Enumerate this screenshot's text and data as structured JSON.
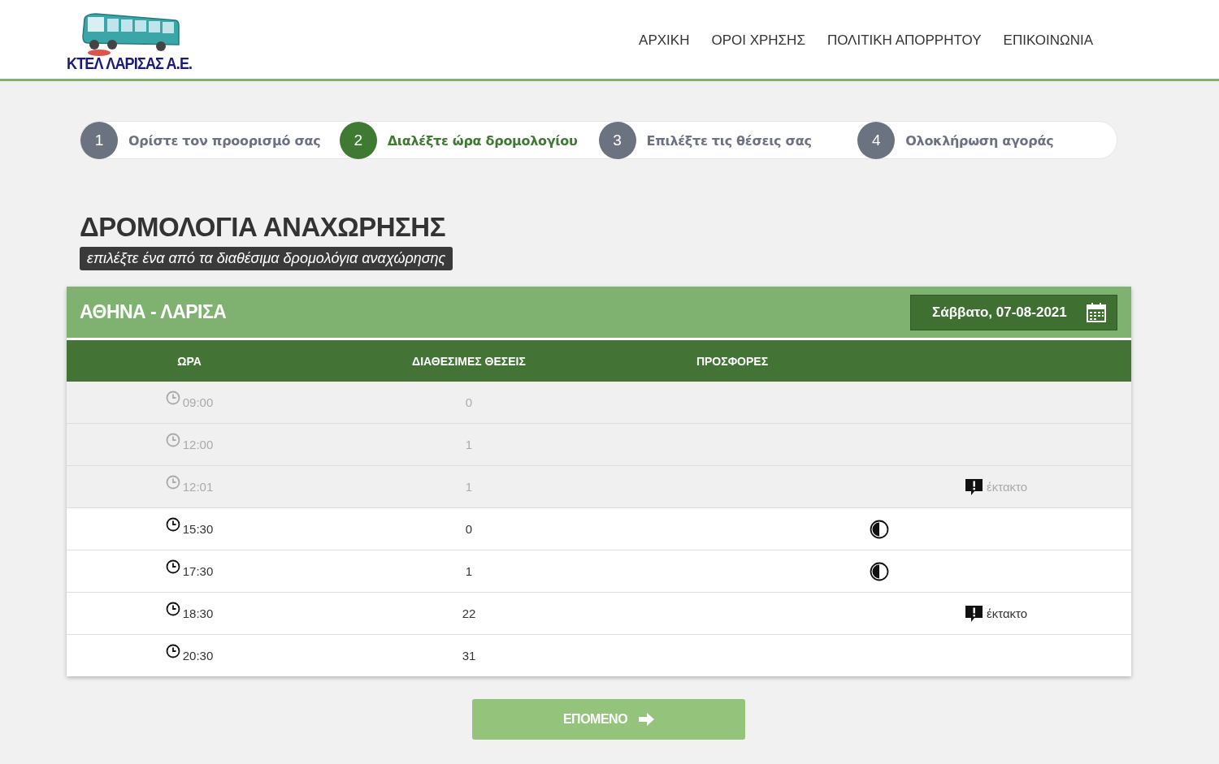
{
  "header": {
    "logo_text": "ΚΤΕΛ ΛΑΡΙΣΑΣ Α.Ε.",
    "nav": [
      "ΑΡΧΙΚΗ",
      "ΟΡΟΙ ΧΡΗΣΗΣ",
      "ΠΟΛΙΤΙΚΗ ΑΠΟΡΡΗΤΟΥ",
      "ΕΠΙΚΟΙΝΩΝΙΑ"
    ]
  },
  "steps": [
    {
      "number": "1",
      "label": "Ορίστε τον προορισμό σας",
      "selected": false
    },
    {
      "number": "2",
      "label": "Διαλέξτε ώρα δρομολογίου",
      "selected": true
    },
    {
      "number": "3",
      "label": "Επιλέξτε τις θέσεις σας",
      "selected": false
    },
    {
      "number": "4",
      "label": "Ολοκλήρωση αγοράς",
      "selected": false
    }
  ],
  "page_title": "ΔΡΟΜΟΛΟΓΙΑ ΑΝΑΧΩΡΗΣΗΣ",
  "subtitle": "επιλέξτε ένα από τα διαθέσιμα δρομολόγια αναχώρησης",
  "schedule": {
    "route": "ΑΘΗΝΑ - ΛΑΡΙΣΑ",
    "date": "Σάββατο, 07-08-2021",
    "columns": [
      "ΩΡΑ",
      "ΔΙΑΘΕΣΙΜΕΣ ΘΕΣΕΙΣ",
      "ΠΡΟΣΦΟΡΕΣ"
    ],
    "rows": [
      {
        "time": "09:00",
        "seats": "0",
        "disabled": true,
        "offer": false
      },
      {
        "time": "12:00",
        "seats": "1",
        "disabled": true,
        "offer": false
      },
      {
        "time": "12:01",
        "seats": "1",
        "disabled": true,
        "offer": false,
        "note": "έκτακτο"
      },
      {
        "time": "15:30",
        "seats": "0",
        "disabled": false,
        "offer": true
      },
      {
        "time": "17:30",
        "seats": "1",
        "disabled": false,
        "offer": true
      },
      {
        "time": "18:30",
        "seats": "22",
        "disabled": false,
        "offer": false,
        "note": "έκτακτο"
      },
      {
        "time": "20:30",
        "seats": "31",
        "disabled": false,
        "offer": false
      }
    ]
  },
  "next_button": "ΕΠΟΜΕΝΟ"
}
